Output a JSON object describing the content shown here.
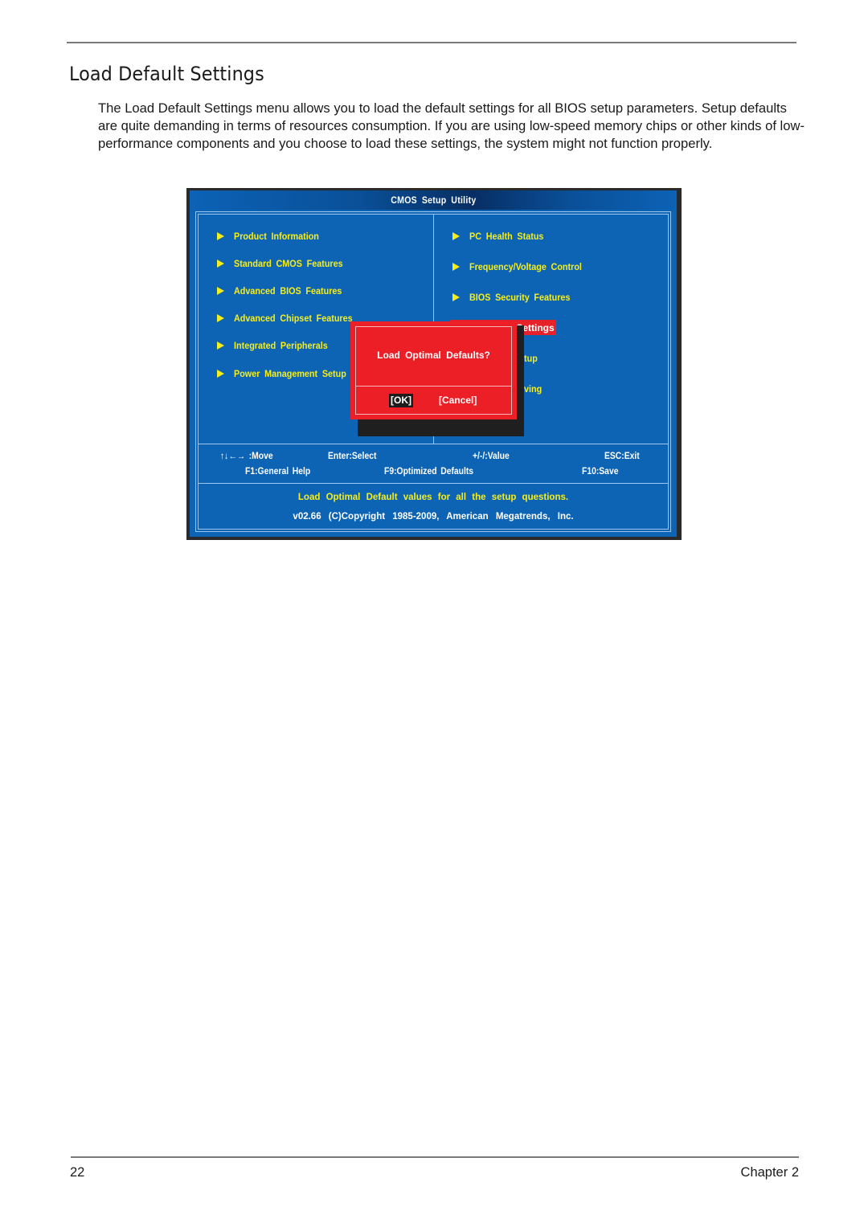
{
  "page": {
    "title": "Load Default Settings",
    "intro": "The Load Default Settings menu allows you to load the default settings for all BIOS setup parameters. Setup defaults are quite demanding in terms of resources consumption. If you are using low-speed memory chips or other kinds of low-performance components and you choose to load these settings, the system might not function properly.",
    "footer": {
      "page_number": "22",
      "chapter": "Chapter 2"
    }
  },
  "bios": {
    "title": "CMOS Setup Utility",
    "colors": {
      "background": "#0e64b4",
      "menu_text": "#f6ee1c",
      "dialog": "#ec1e26",
      "highlight": "#e62129"
    },
    "left_menu": [
      {
        "label": "Product Information",
        "icon": "triangle-right-icon"
      },
      {
        "label": "Standard CMOS Features",
        "icon": "triangle-right-icon"
      },
      {
        "label": "Advanced BIOS Features",
        "icon": "triangle-right-icon"
      },
      {
        "label": "Advanced Chipset Features",
        "icon": "triangle-right-icon"
      },
      {
        "label": "Integrated Peripherals",
        "icon": "triangle-right-icon"
      },
      {
        "label": "Power Management Setup",
        "icon": "triangle-right-icon"
      }
    ],
    "right_menu": [
      {
        "label": "PC Health Status",
        "icon": "triangle-right-icon"
      },
      {
        "label": "Frequency/Voltage Control",
        "icon": "triangle-right-icon"
      },
      {
        "label": "BIOS Security Features",
        "icon": "triangle-right-icon"
      },
      {
        "label": "Settings",
        "selected": true
      },
      {
        "label": "etup"
      },
      {
        "label": "aving"
      }
    ],
    "hints": {
      "move": "↑↓←→ :Move",
      "select": "Enter:Select",
      "value": "+/-/:Value",
      "exit": "ESC:Exit",
      "help": "F1:General Help",
      "defaults": "F9:Optimized Defaults",
      "save": "F10:Save"
    },
    "help_text": "Load Optimal Default values for all the setup questions.",
    "copyright": "v02.66 (C)Copyright 1985-2009, American Megatrends, Inc.",
    "dialog": {
      "question": "Load Optimal Defaults?",
      "ok_label": "[OK]",
      "cancel_label": "[Cancel]",
      "focused": "ok"
    }
  }
}
